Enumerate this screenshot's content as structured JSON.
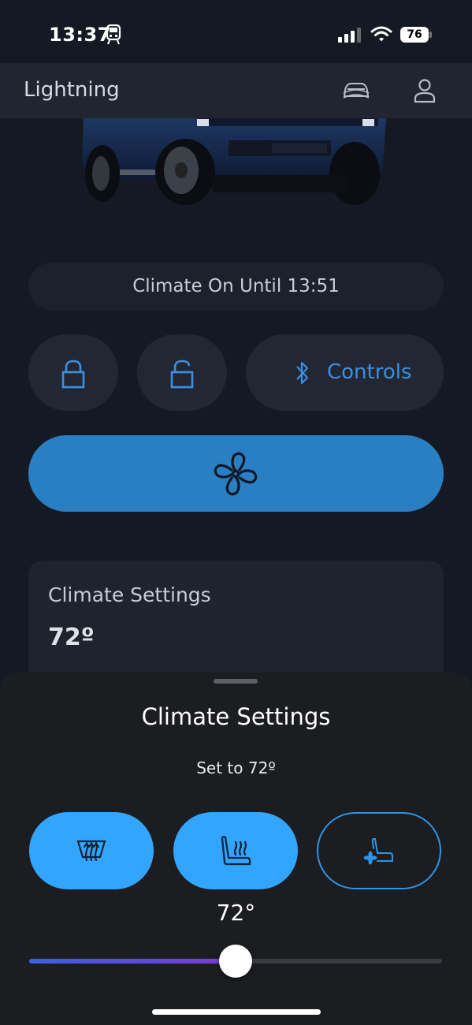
{
  "status_bar": {
    "time": "13:37",
    "battery": "76"
  },
  "header": {
    "title": "Lightning"
  },
  "climate_status": "Climate On Until 13:51",
  "controls": {
    "label": "Controls"
  },
  "card": {
    "title": "Climate Settings",
    "temp": "72º"
  },
  "sheet": {
    "title": "Climate Settings",
    "subtitle": "Set to 72º",
    "slider_value": "72°",
    "slider_level": 0.5
  },
  "colors": {
    "accent": "#31a5ff",
    "primary_button": "#2a7ec2",
    "link": "#3b8fe0"
  }
}
